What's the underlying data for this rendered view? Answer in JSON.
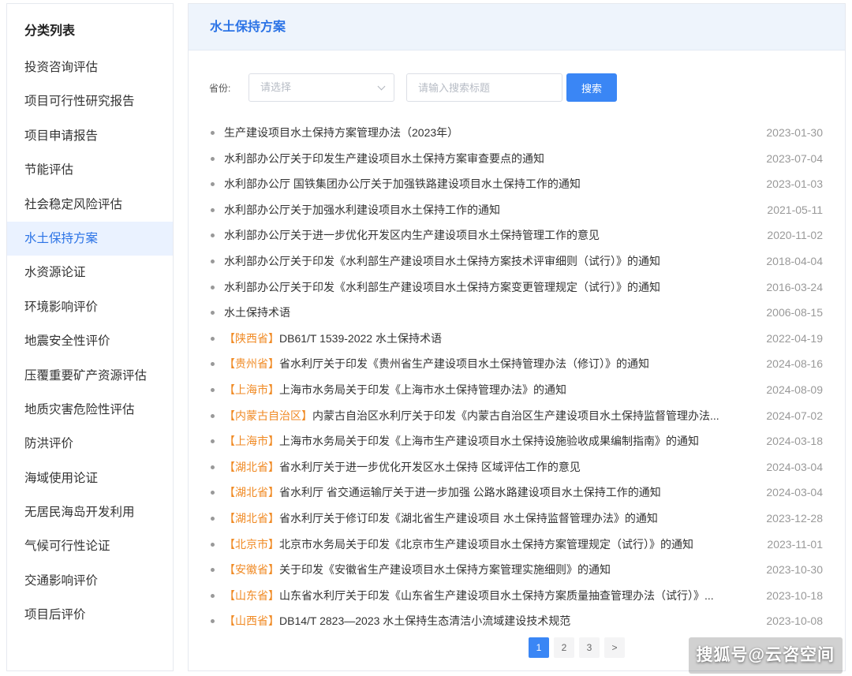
{
  "sidebar": {
    "title": "分类列表",
    "items": [
      {
        "label": "投资咨询评估",
        "active": false
      },
      {
        "label": "项目可行性研究报告",
        "active": false
      },
      {
        "label": "项目申请报告",
        "active": false
      },
      {
        "label": "节能评估",
        "active": false
      },
      {
        "label": "社会稳定风险评估",
        "active": false
      },
      {
        "label": "水土保持方案",
        "active": true
      },
      {
        "label": "水资源论证",
        "active": false
      },
      {
        "label": "环境影响评价",
        "active": false
      },
      {
        "label": "地震安全性评价",
        "active": false
      },
      {
        "label": "压覆重要矿产资源评估",
        "active": false
      },
      {
        "label": "地质灾害危险性评估",
        "active": false
      },
      {
        "label": "防洪评价",
        "active": false
      },
      {
        "label": "海域使用论证",
        "active": false
      },
      {
        "label": "无居民海岛开发利用",
        "active": false
      },
      {
        "label": "气候可行性论证",
        "active": false
      },
      {
        "label": "交通影响评价",
        "active": false
      },
      {
        "label": "项目后评价",
        "active": false
      }
    ]
  },
  "main": {
    "title": "水土保持方案",
    "filter": {
      "province_label": "省份:",
      "province_placeholder": "请选择",
      "search_placeholder": "请输入搜索标题",
      "search_button": "搜索"
    },
    "articles": [
      {
        "province": "",
        "title": "生产建设项目水土保持方案管理办法（2023年）",
        "date": "2023-01-30"
      },
      {
        "province": "",
        "title": "水利部办公厅关于印发生产建设项目水土保持方案审查要点的通知",
        "date": "2023-07-04"
      },
      {
        "province": "",
        "title": "水利部办公厅 国铁集团办公厅关于加强铁路建设项目水土保持工作的通知",
        "date": "2023-01-03"
      },
      {
        "province": "",
        "title": "水利部办公厅关于加强水利建设项目水土保持工作的通知",
        "date": "2021-05-11"
      },
      {
        "province": "",
        "title": "水利部办公厅关于进一步优化开发区内生产建设项目水土保持管理工作的意见",
        "date": "2020-11-02"
      },
      {
        "province": "",
        "title": "水利部办公厅关于印发《水利部生产建设项目水土保持方案技术评审细则（试行）》的通知",
        "date": "2018-04-04"
      },
      {
        "province": "",
        "title": "水利部办公厅关于印发《水利部生产建设项目水土保持方案变更管理规定（试行）》的通知",
        "date": "2016-03-24"
      },
      {
        "province": "",
        "title": "水土保持术语",
        "date": "2006-08-15"
      },
      {
        "province": "【陕西省】",
        "title": "DB61/T 1539-2022   水土保持术语",
        "date": "2022-04-19"
      },
      {
        "province": "【贵州省】",
        "title": "省水利厅关于印发《贵州省生产建设项目水土保持管理办法（修订）》的通知",
        "date": "2024-08-16"
      },
      {
        "province": "【上海市】",
        "title": "上海市水务局关于印发《上海市水土保持管理办法》的通知",
        "date": "2024-08-09"
      },
      {
        "province": "【内蒙古自治区】",
        "title": "内蒙古自治区水利厅关于印发《内蒙古自治区生产建设项目水土保持监督管理办法...",
        "date": "2024-07-02"
      },
      {
        "province": "【上海市】",
        "title": "上海市水务局关于印发《上海市生产建设项目水土保持设施验收成果编制指南》的通知",
        "date": "2024-03-18"
      },
      {
        "province": "【湖北省】",
        "title": "省水利厅关于进一步优化开发区水土保持 区域评估工作的意见",
        "date": "2024-03-04"
      },
      {
        "province": "【湖北省】",
        "title": "省水利厅 省交通运输厅关于进一步加强 公路水路建设项目水土保持工作的通知",
        "date": "2024-03-04"
      },
      {
        "province": "【湖北省】",
        "title": "省水利厅关于修订印发《湖北省生产建设项目 水土保持监督管理办法》的通知",
        "date": "2023-12-28"
      },
      {
        "province": "【北京市】",
        "title": "北京市水务局关于印发《北京市生产建设项目水土保持方案管理规定（试行）》的通知",
        "date": "2023-11-01"
      },
      {
        "province": "【安徽省】",
        "title": "关于印发《安徽省生产建设项目水土保持方案管理实施细则》的通知",
        "date": "2023-10-30"
      },
      {
        "province": "【山东省】",
        "title": "山东省水利厅关于印发《山东省生产建设项目水土保持方案质量抽查管理办法（试行）》...",
        "date": "2023-10-18"
      },
      {
        "province": "【山西省】",
        "title": "DB14/T 2823—2023   水土保持生态清洁小流域建设技术规范",
        "date": "2023-10-08"
      }
    ],
    "pagination": {
      "pages": [
        "1",
        "2",
        "3",
        ">"
      ],
      "current": "1"
    }
  },
  "watermark": "搜狐号@云咨空间"
}
